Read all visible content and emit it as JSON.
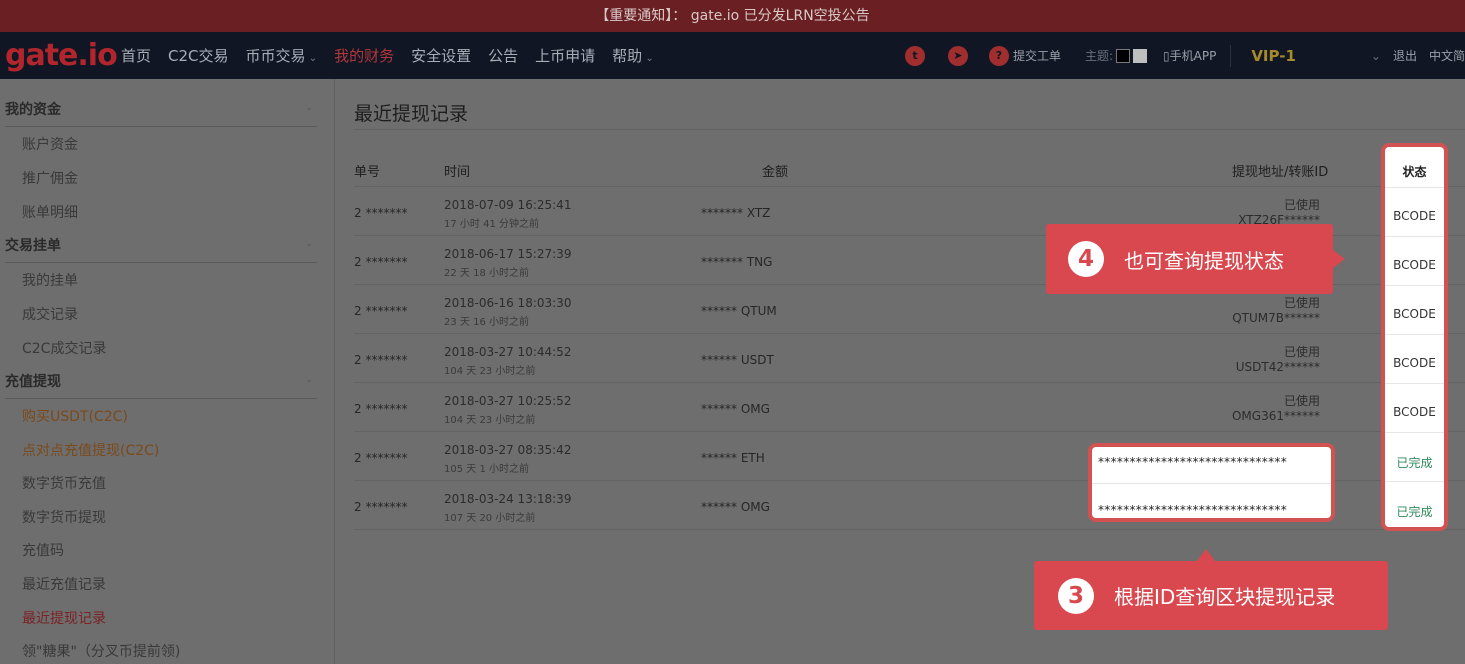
{
  "notice": "【重要通知】： gate.io 已分发LRN空投公告",
  "logo": "gate.io",
  "nav": {
    "items": [
      "首页",
      "C2C交易",
      "币币交易",
      "我的财务",
      "安全设置",
      "公告",
      "上币申请",
      "帮助"
    ],
    "right": {
      "ticket": "提交工单",
      "theme_label": "主题:",
      "app": "▯手机APP",
      "vip": "VIP-1",
      "logout": "退出",
      "lang": "中文简"
    }
  },
  "sidebar": {
    "groups": [
      {
        "title": "我的资金",
        "items": [
          "账户资金",
          "推广佣金",
          "账单明细"
        ]
      },
      {
        "title": "交易挂单",
        "items": [
          "我的挂单",
          "成交记录",
          "C2C成交记录"
        ]
      },
      {
        "title": "充值提现",
        "items": [
          "购买USDT(C2C)",
          "点对点充值提现(C2C)",
          "数字货币充值",
          "数字货币提现",
          "充值码",
          "最近充值记录",
          "最近提现记录",
          "领\"糖果\"（分叉币提前领)"
        ]
      }
    ]
  },
  "main": {
    "title": "最近提现记录",
    "columns": {
      "id": "单号",
      "time": "时间",
      "amount": "金额",
      "address": "提现地址/转账ID",
      "status": "状态"
    },
    "rows": [
      {
        "id": "2 *******",
        "time": "2018-07-09 16:25:41",
        "ago": "17 小时 41 分钟之前",
        "amount": "******* XTZ",
        "addr_status": "已使用",
        "addr": "XTZ26F******",
        "status": "BCODE"
      },
      {
        "id": "2 *******",
        "time": "2018-06-17 15:27:39",
        "ago": "22 天 18 小时之前",
        "amount": "******* TNG",
        "addr_status": "",
        "addr": "",
        "status": "BCODE"
      },
      {
        "id": "2 *******",
        "time": "2018-06-16 18:03:30",
        "ago": "23 天 16 小时之前",
        "amount": "****** QTUM",
        "addr_status": "已使用",
        "addr": "QTUM7B******",
        "status": "BCODE"
      },
      {
        "id": "2 *******",
        "time": "2018-03-27 10:44:52",
        "ago": "104 天 23 小时之前",
        "amount": "****** USDT",
        "addr_status": "已使用",
        "addr": "USDT42******",
        "status": "BCODE"
      },
      {
        "id": "2 *******",
        "time": "2018-03-27 10:25:52",
        "ago": "104 天 23 小时之前",
        "amount": "******  OMG",
        "addr_status": "已使用",
        "addr": "OMG361******",
        "status": "BCODE"
      },
      {
        "id": "2 *******",
        "time": "2018-03-27 08:35:42",
        "ago": "105 天 1 小时之前",
        "amount": "******   ETH",
        "addr_status": "",
        "addr": "******************************",
        "status": "已完成"
      },
      {
        "id": "2 *******",
        "time": "2018-03-24 13:18:39",
        "ago": "107 天 20 小时之前",
        "amount": "******  OMG",
        "addr_status": "",
        "addr": "******************************",
        "status": "已完成"
      }
    ]
  },
  "callouts": {
    "c4": {
      "num": "4",
      "text": "也可查询提现状态"
    },
    "c3": {
      "num": "3",
      "text": "根据ID查询区块提现记录"
    }
  },
  "colors": {
    "brand": "#b1262c",
    "callout": "#d9474f",
    "done": "#2f8a5c"
  }
}
